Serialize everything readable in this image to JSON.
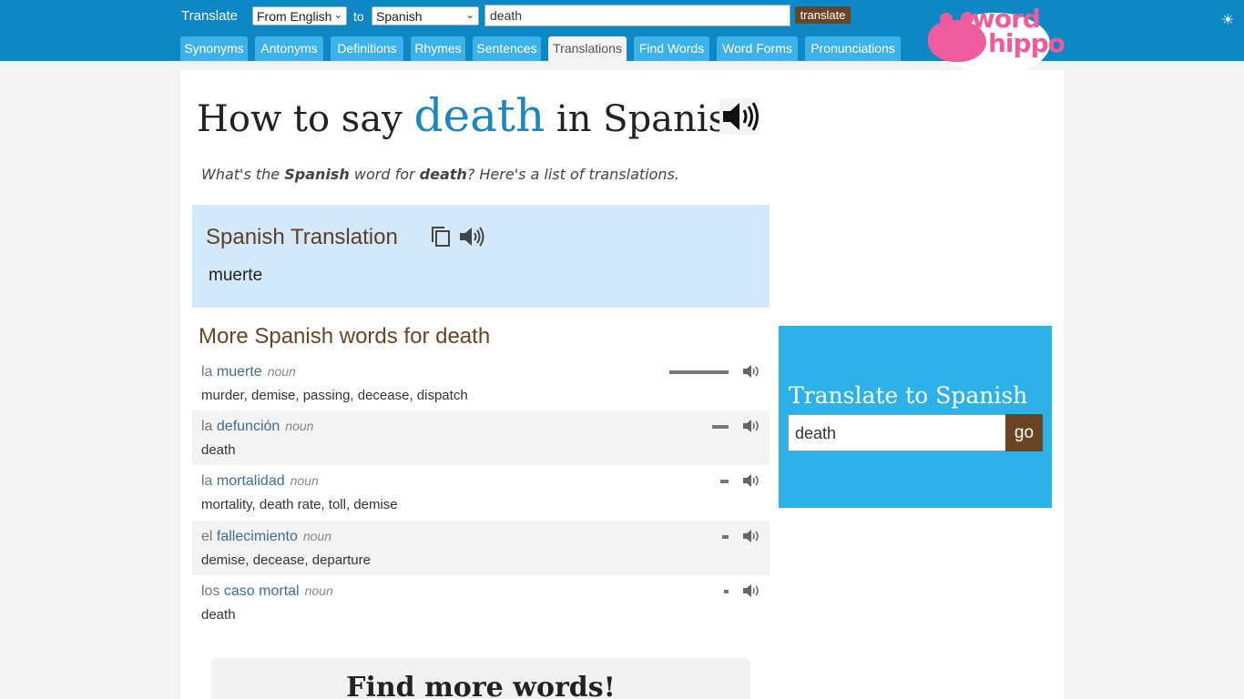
{
  "header": {
    "translate_label": "Translate",
    "from_select": "From English",
    "to_label": "to",
    "to_select": "Spanish",
    "search_value": "death",
    "translate_button": "translate",
    "tabs": [
      {
        "label": "Synonyms"
      },
      {
        "label": "Antonyms"
      },
      {
        "label": "Definitions"
      },
      {
        "label": "Rhymes"
      },
      {
        "label": "Sentences"
      },
      {
        "label": "Translations",
        "active": true
      },
      {
        "label": "Find Words"
      },
      {
        "label": "Word Forms"
      },
      {
        "label": "Pronunciations"
      }
    ],
    "logo_top": "word",
    "logo_bottom": "hippo"
  },
  "page": {
    "title_pre": "How to say",
    "title_word": "death",
    "title_post": "in Spanish",
    "subtitle_1": "What's the",
    "subtitle_2": "Spanish",
    "subtitle_3": "word for",
    "subtitle_4": "death",
    "subtitle_5": "? Here's a list of translations."
  },
  "translation_box": {
    "title": "Spanish Translation",
    "word": "muerte"
  },
  "more_words": {
    "title": "More Spanish words for death",
    "items": [
      {
        "article": "la",
        "word": "muerte",
        "pos": "noun",
        "synonyms": "murder, demise, passing, decease, dispatch",
        "frequency": 1.0
      },
      {
        "article": "la",
        "word": "defunción",
        "pos": "noun",
        "synonyms": "death",
        "frequency": 0.28
      },
      {
        "article": "la",
        "word": "mortalidad",
        "pos": "noun",
        "synonyms": "mortality, death rate, toll, demise",
        "frequency": 0.14
      },
      {
        "article": "el",
        "word": "fallecimiento",
        "pos": "noun",
        "synonyms": "demise, decease, departure",
        "frequency": 0.11
      },
      {
        "article": "los",
        "word": "caso mortal",
        "pos": "noun",
        "synonyms": "death",
        "frequency": 0.07
      }
    ]
  },
  "sidebar": {
    "title": "Translate to Spanish",
    "input_value": "death",
    "go_button": "go"
  },
  "find_more": {
    "title": "Find more words!"
  }
}
